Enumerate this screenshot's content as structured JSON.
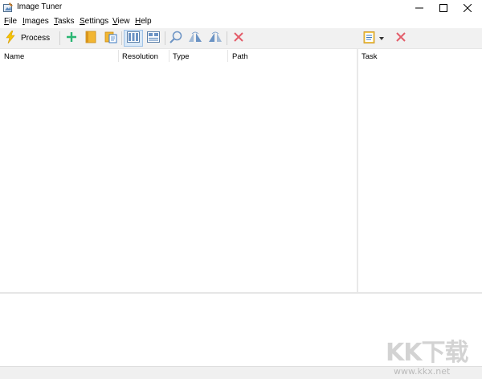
{
  "window": {
    "title": "Image Tuner",
    "icons": {
      "app": "image-tuner-app-icon",
      "minimize": "minimize-icon",
      "maximize": "maximize-icon",
      "close": "close-icon"
    }
  },
  "menu": {
    "items": [
      {
        "name": "file",
        "label": "File",
        "accel": "F",
        "rest": "ile"
      },
      {
        "name": "images",
        "label": "Images",
        "accel": "I",
        "rest": "mages"
      },
      {
        "name": "tasks",
        "label": "Tasks",
        "accel": "T",
        "rest": "asks"
      },
      {
        "name": "settings",
        "label": "Settings",
        "accel": "S",
        "rest": "ettings"
      },
      {
        "name": "view",
        "label": "View",
        "accel": "V",
        "rest": "iew"
      },
      {
        "name": "help",
        "label": "Help",
        "accel": "H",
        "rest": "elp"
      }
    ]
  },
  "toolbar": {
    "process_label": "Process",
    "icons": [
      "lightning-icon",
      "add-icon",
      "add-folder-icon",
      "paste-icon",
      "view-list-icon",
      "view-details-icon",
      "zoom-icon",
      "flip-horizontal-icon",
      "flip-vertical-icon",
      "remove-icon",
      "task-list-icon",
      "dropdown-arrow-icon",
      "remove-task-icon"
    ],
    "colors": {
      "add": "#2bb673",
      "remove": "#e35d6a",
      "folder": "#f2b632",
      "lightning": "#f5c400"
    }
  },
  "list": {
    "columns": [
      "Name",
      "Resolution",
      "Type",
      "Path"
    ]
  },
  "tasks": {
    "header": "Task"
  },
  "watermark": {
    "logo": "KK下载",
    "url": "www.kkx.net"
  }
}
